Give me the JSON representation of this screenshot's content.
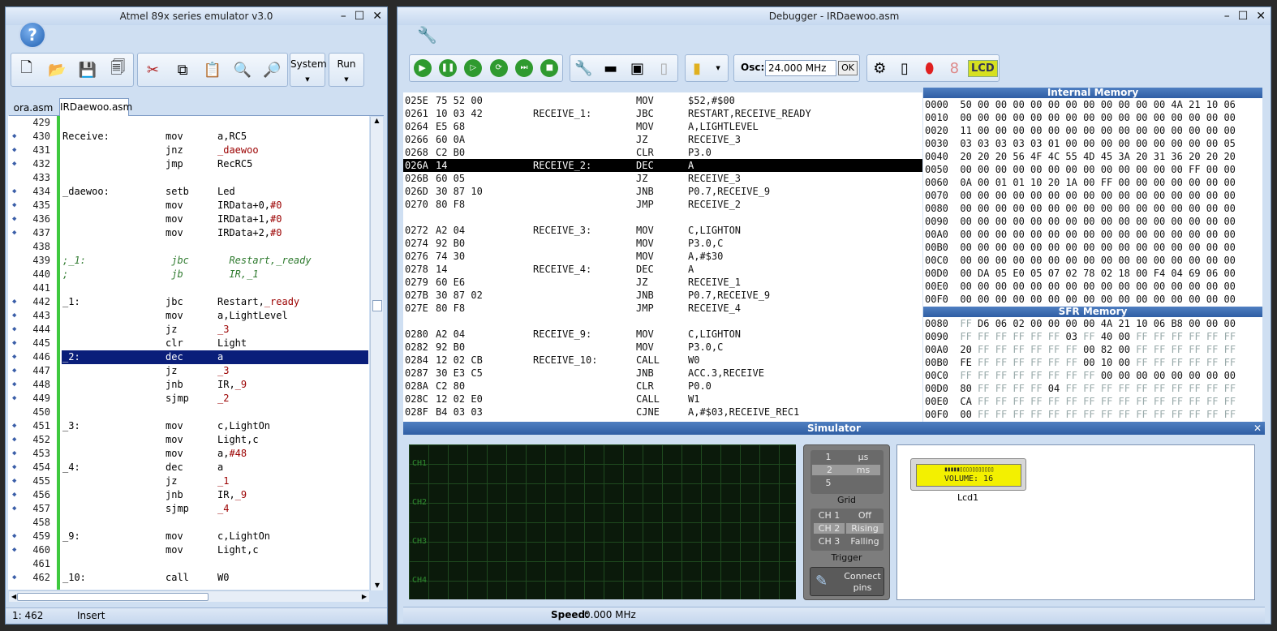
{
  "left_window": {
    "title": "Atmel 89x series emulator v3.0",
    "help_icon": "?",
    "toolbar": {
      "system_label": "System",
      "run_label": "Run"
    },
    "tabs": [
      "ora.asm",
      "IRDaewoo.asm"
    ],
    "lines": [
      {
        "n": "429",
        "dot": false,
        "lab": "",
        "ins": "",
        "ops": ""
      },
      {
        "n": "430",
        "dot": true,
        "lab": "Receive:",
        "ins": "mov",
        "ops": "a,RC5"
      },
      {
        "n": "431",
        "dot": true,
        "lab": "",
        "ins": "jnz",
        "ops": "_daewoo"
      },
      {
        "n": "432",
        "dot": true,
        "lab": "",
        "ins": "jmp",
        "ops": "RecRC5"
      },
      {
        "n": "433",
        "dot": false,
        "lab": "",
        "ins": "",
        "ops": ""
      },
      {
        "n": "434",
        "dot": true,
        "lab": "_daewoo:",
        "ins": "setb",
        "ops": "Led"
      },
      {
        "n": "435",
        "dot": true,
        "lab": "",
        "ins": "mov",
        "ops": "IRData+0,#0"
      },
      {
        "n": "436",
        "dot": true,
        "lab": "",
        "ins": "mov",
        "ops": "IRData+1,#0"
      },
      {
        "n": "437",
        "dot": true,
        "lab": "",
        "ins": "mov",
        "ops": "IRData+2,#0"
      },
      {
        "n": "438",
        "dot": false,
        "lab": "",
        "ins": "",
        "ops": ""
      },
      {
        "n": "439",
        "dot": false,
        "lab": ";_1:",
        "ins": " jbc",
        "ops": "  Restart,_ready",
        "comment": true
      },
      {
        "n": "440",
        "dot": false,
        "lab": ";",
        "ins": " jb",
        "ops": "  IR,_1",
        "comment": true
      },
      {
        "n": "441",
        "dot": false,
        "lab": "",
        "ins": "",
        "ops": ""
      },
      {
        "n": "442",
        "dot": true,
        "lab": "_1:",
        "ins": "jbc",
        "ops": "Restart,_ready"
      },
      {
        "n": "443",
        "dot": true,
        "lab": "",
        "ins": "mov",
        "ops": "a,LightLevel"
      },
      {
        "n": "444",
        "dot": true,
        "lab": "",
        "ins": "jz",
        "ops": "_3"
      },
      {
        "n": "445",
        "dot": true,
        "lab": "",
        "ins": "clr",
        "ops": "Light"
      },
      {
        "n": "446",
        "dot": true,
        "lab": "_2:",
        "ins": "dec",
        "ops": "a",
        "hl": true
      },
      {
        "n": "447",
        "dot": true,
        "lab": "",
        "ins": "jz",
        "ops": "_3"
      },
      {
        "n": "448",
        "dot": true,
        "lab": "",
        "ins": "jnb",
        "ops": "IR,_9"
      },
      {
        "n": "449",
        "dot": true,
        "lab": "",
        "ins": "sjmp",
        "ops": "_2"
      },
      {
        "n": "450",
        "dot": false,
        "lab": "",
        "ins": "",
        "ops": ""
      },
      {
        "n": "451",
        "dot": true,
        "lab": "_3:",
        "ins": "mov",
        "ops": "c,LightOn"
      },
      {
        "n": "452",
        "dot": true,
        "lab": "",
        "ins": "mov",
        "ops": "Light,c"
      },
      {
        "n": "453",
        "dot": true,
        "lab": "",
        "ins": "mov",
        "ops": "a,#48"
      },
      {
        "n": "454",
        "dot": true,
        "lab": "_4:",
        "ins": "dec",
        "ops": "a"
      },
      {
        "n": "455",
        "dot": true,
        "lab": "",
        "ins": "jz",
        "ops": "_1"
      },
      {
        "n": "456",
        "dot": true,
        "lab": "",
        "ins": "jnb",
        "ops": "IR,_9"
      },
      {
        "n": "457",
        "dot": true,
        "lab": "",
        "ins": "sjmp",
        "ops": "_4"
      },
      {
        "n": "458",
        "dot": false,
        "lab": "",
        "ins": "",
        "ops": ""
      },
      {
        "n": "459",
        "dot": true,
        "lab": "_9:",
        "ins": "mov",
        "ops": "c,LightOn"
      },
      {
        "n": "460",
        "dot": true,
        "lab": "",
        "ins": "mov",
        "ops": "Light,c"
      },
      {
        "n": "461",
        "dot": false,
        "lab": "",
        "ins": "",
        "ops": ""
      },
      {
        "n": "462",
        "dot": true,
        "lab": "_10:",
        "ins": "call",
        "ops": "W0"
      }
    ],
    "status": {
      "position": "1: 462",
      "mode": "Insert"
    }
  },
  "debugger": {
    "title": "Debugger - IRDaewoo.asm",
    "osc_label": "Osc:",
    "osc_value": "24.000 MHz",
    "ok_label": "OK",
    "lcd_label": "LCD",
    "code": [
      {
        "addr": "025E",
        "bytes": "75 52 00",
        "lab": "",
        "ins": "MOV",
        "ops": "$52,#$00"
      },
      {
        "addr": "0261",
        "bytes": "10 03 42",
        "lab": "RECEIVE_1:",
        "ins": "JBC",
        "ops": "RESTART,RECEIVE_READY"
      },
      {
        "addr": "0264",
        "bytes": "E5 68",
        "lab": "",
        "ins": "MOV",
        "ops": "A,LIGHTLEVEL"
      },
      {
        "addr": "0266",
        "bytes": "60 0A",
        "lab": "",
        "ins": "JZ",
        "ops": "RECEIVE_3"
      },
      {
        "addr": "0268",
        "bytes": "C2 B0",
        "lab": "",
        "ins": "CLR",
        "ops": "P3.0"
      },
      {
        "addr": "026A",
        "bytes": "14",
        "lab": "RECEIVE_2:",
        "ins": "DEC",
        "ops": "A",
        "hl": true
      },
      {
        "addr": "026B",
        "bytes": "60 05",
        "lab": "",
        "ins": "JZ",
        "ops": "RECEIVE_3"
      },
      {
        "addr": "026D",
        "bytes": "30 87 10",
        "lab": "",
        "ins": "JNB",
        "ops": "P0.7,RECEIVE_9"
      },
      {
        "addr": "0270",
        "bytes": "80 F8",
        "lab": "",
        "ins": "JMP",
        "ops": "RECEIVE_2"
      },
      {
        "addr": "",
        "bytes": "",
        "lab": "",
        "ins": "",
        "ops": ""
      },
      {
        "addr": "0272",
        "bytes": "A2 04",
        "lab": "RECEIVE_3:",
        "ins": "MOV",
        "ops": "C,LIGHTON"
      },
      {
        "addr": "0274",
        "bytes": "92 B0",
        "lab": "",
        "ins": "MOV",
        "ops": "P3.0,C"
      },
      {
        "addr": "0276",
        "bytes": "74 30",
        "lab": "",
        "ins": "MOV",
        "ops": "A,#$30"
      },
      {
        "addr": "0278",
        "bytes": "14",
        "lab": "RECEIVE_4:",
        "ins": "DEC",
        "ops": "A"
      },
      {
        "addr": "0279",
        "bytes": "60 E6",
        "lab": "",
        "ins": "JZ",
        "ops": "RECEIVE_1"
      },
      {
        "addr": "027B",
        "bytes": "30 87 02",
        "lab": "",
        "ins": "JNB",
        "ops": "P0.7,RECEIVE_9"
      },
      {
        "addr": "027E",
        "bytes": "80 F8",
        "lab": "",
        "ins": "JMP",
        "ops": "RECEIVE_4"
      },
      {
        "addr": "",
        "bytes": "",
        "lab": "",
        "ins": "",
        "ops": ""
      },
      {
        "addr": "0280",
        "bytes": "A2 04",
        "lab": "RECEIVE_9:",
        "ins": "MOV",
        "ops": "C,LIGHTON"
      },
      {
        "addr": "0282",
        "bytes": "92 B0",
        "lab": "",
        "ins": "MOV",
        "ops": "P3.0,C"
      },
      {
        "addr": "0284",
        "bytes": "12 02 CB",
        "lab": "RECEIVE_10:",
        "ins": "CALL",
        "ops": "W0"
      },
      {
        "addr": "0287",
        "bytes": "30 E3 C5",
        "lab": "",
        "ins": "JNB",
        "ops": "ACC.3,RECEIVE"
      },
      {
        "addr": "028A",
        "bytes": "C2 80",
        "lab": "",
        "ins": "CLR",
        "ops": "P0.0"
      },
      {
        "addr": "028C",
        "bytes": "12 02 E0",
        "lab": "",
        "ins": "CALL",
        "ops": "W1"
      },
      {
        "addr": "028F",
        "bytes": "B4 03 03",
        "lab": "",
        "ins": "CJNE",
        "ops": "A,#$03,RECEIVE_REC1"
      }
    ],
    "internal_memory_title": "Internal Memory",
    "internal_memory": [
      "0000  50 00 00 00 00 00 00 00 00 00 00 00 4A 21 10 06",
      "0010  00 00 00 00 00 00 00 00 00 00 00 00 00 00 00 00",
      "0020  11 00 00 00 00 00 00 00 00 00 00 00 00 00 00 00",
      "0030  03 03 03 03 03 01 00 00 00 00 00 00 00 00 00 05",
      "0040  20 20 20 56 4F 4C 55 4D 45 3A 20 31 36 20 20 20",
      "0050  00 00 00 00 00 00 00 00 00 00 00 00 00 FF 00 00",
      "0060  0A 00 01 01 10 20 1A 00 FF 00 00 00 00 00 00 00",
      "0070  00 00 00 00 00 00 00 00 00 00 00 00 00 00 00 00",
      "0080  00 00 00 00 00 00 00 00 00 00 00 00 00 00 00 00",
      "0090  00 00 00 00 00 00 00 00 00 00 00 00 00 00 00 00",
      "00A0  00 00 00 00 00 00 00 00 00 00 00 00 00 00 00 00",
      "00B0  00 00 00 00 00 00 00 00 00 00 00 00 00 00 00 00",
      "00C0  00 00 00 00 00 00 00 00 00 00 00 00 00 00 00 00",
      "00D0  00 DA 05 E0 05 07 02 78 02 18 00 F4 04 69 06 00",
      "00E0  00 00 00 00 00 00 00 00 00 00 00 00 00 00 00 00",
      "00F0  00 00 00 00 00 00 00 00 00 00 00 00 00 00 00 00"
    ],
    "sfr_memory_title": "SFR Memory",
    "sfr_memory": [
      "0080  FF D6 06 02 00 00 00 00 4A 21 10 06 B8 00 00 00",
      "0090  FF FF FF FF FF FF 03 FF 40 00 FF FF FF FF FF FF",
      "00A0  20 FF FF FF FF FF FF 00 82 00 FF FF FF FF FF FF",
      "00B0  FE FF FF FF FF FF FF 00 10 00 FF FF FF FF FF FF",
      "00C0  FF FF FF FF FF FF FF FF 00 00 00 00 00 00 00 00",
      "00D0  80 FF FF FF FF 04 FF FF FF FF FF FF FF FF FF FF",
      "00E0  CA FF FF FF FF FF FF FF FF FF FF FF FF FF FF FF",
      "00F0  00 FF FF FF FF FF FF FF FF FF FF FF FF FF FF FF"
    ]
  },
  "simulator": {
    "title": "Simulator",
    "channels": [
      "CH1",
      "CH2",
      "CH3",
      "CH4"
    ],
    "grid": {
      "values": [
        "1",
        "2",
        "5"
      ],
      "units": [
        "µs",
        "ms",
        ""
      ],
      "label": "Grid"
    },
    "trigger": {
      "channels": [
        "CH 1",
        "CH 2",
        "CH 3"
      ],
      "modes": [
        "Off",
        "Rising",
        "Falling"
      ],
      "label": "Trigger"
    },
    "connect_label": "Connect pins",
    "lcd": {
      "bars": "▮▮▮▮▮▯▯▯▯▯▯▯▯▯▯▯",
      "text": "VOLUME: 16",
      "name": "Lcd1"
    },
    "speed_label": "Speed:",
    "speed_value": "0.000 MHz"
  },
  "colors": {
    "highlight_blue": "#0a1e7a",
    "gutter_green": "#3fc93f",
    "scope_bg": "#0b1a0b",
    "lcd_yellow": "#f3f000"
  }
}
